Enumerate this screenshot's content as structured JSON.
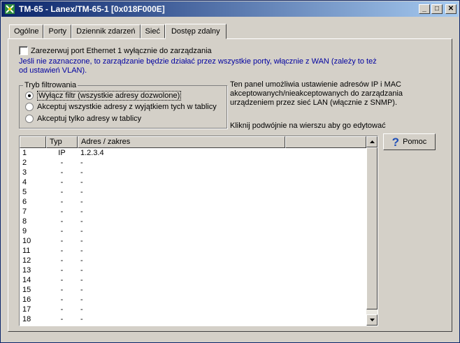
{
  "window": {
    "title": "TM-65 - Lanex/TM-65-1 [0x018F000E]",
    "buttons": {
      "minimize": "_",
      "maximize": "□",
      "close": "✕"
    }
  },
  "tabs": [
    {
      "label": "Ogólne",
      "active": false
    },
    {
      "label": "Porty",
      "active": false
    },
    {
      "label": "Dziennik zdarzeń",
      "active": false
    },
    {
      "label": "Sieć",
      "active": false
    },
    {
      "label": "Dostęp zdalny",
      "active": true
    }
  ],
  "reserve_port": {
    "label": "Zarezerwuj port Ethernet 1 wyłącznie do zarządzania",
    "checked": false,
    "note": "Jeśli nie zaznaczone, to zarządzanie będzie działać przez wszystkie porty, włącznie z WAN (zależy to też od ustawień VLAN)."
  },
  "filter_mode": {
    "legend": "Tryb filtrowania",
    "options": [
      {
        "label": "Wyłącz filtr (wszystkie adresy dozwolone)",
        "selected": true
      },
      {
        "label": "Akceptuj wszystkie adresy z wyjątkiem tych w tablicy",
        "selected": false
      },
      {
        "label": "Akceptuj tylko adresy w tablicy",
        "selected": false
      }
    ]
  },
  "description": "Ten panel umożliwia ustawienie adresów IP i MAC akceptowanych/nieakceptowanych do zarządzania urządzeniem przez sieć LAN (włącznie z SNMP).",
  "hint": "Kliknij podwójnie na wierszu aby go edytować",
  "help_button": {
    "label": "Pomoc",
    "icon": "question-icon"
  },
  "table": {
    "columns": [
      "",
      "Typ",
      "Adres / zakres",
      ""
    ],
    "rows": [
      [
        "1",
        "IP",
        "1.2.3.4"
      ],
      [
        "2",
        "-",
        "-"
      ],
      [
        "3",
        "-",
        "-"
      ],
      [
        "4",
        "-",
        "-"
      ],
      [
        "5",
        "-",
        "-"
      ],
      [
        "6",
        "-",
        "-"
      ],
      [
        "7",
        "-",
        "-"
      ],
      [
        "8",
        "-",
        "-"
      ],
      [
        "9",
        "-",
        "-"
      ],
      [
        "10",
        "-",
        "-"
      ],
      [
        "11",
        "-",
        "-"
      ],
      [
        "12",
        "-",
        "-"
      ],
      [
        "13",
        "-",
        "-"
      ],
      [
        "14",
        "-",
        "-"
      ],
      [
        "15",
        "-",
        "-"
      ],
      [
        "16",
        "-",
        "-"
      ],
      [
        "17",
        "-",
        "-"
      ],
      [
        "18",
        "-",
        "-"
      ]
    ]
  },
  "colors": {
    "note_text": "#0000a0",
    "titlebar_start": "#0a246a",
    "titlebar_end": "#a6caf0"
  }
}
